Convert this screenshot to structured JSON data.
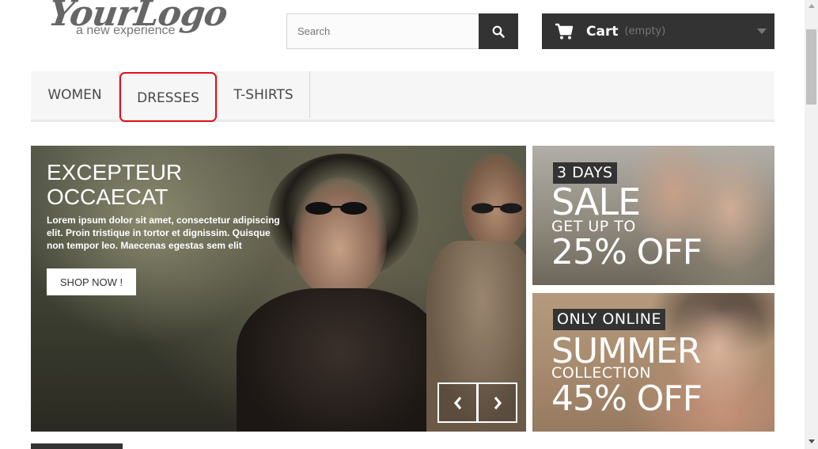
{
  "logo": {
    "script_text": "YourLogo",
    "tagline": "a new experience"
  },
  "search": {
    "placeholder": "Search",
    "value": ""
  },
  "cart": {
    "label": "Cart",
    "status": "(empty)"
  },
  "menu": {
    "items": [
      {
        "label": "WOMEN"
      },
      {
        "label": "DRESSES"
      },
      {
        "label": "T-SHIRTS"
      }
    ],
    "highlight_color": "#e0121a"
  },
  "slider": {
    "heading": "EXCEPTEUR OCCAECAT",
    "text": "Lorem ipsum dolor sit amet, consectetur adipiscing elit. Proin tristique in tortor et dignissim. Quisque non tempor leo. Maecenas egestas sem elit",
    "button_label": "SHOP NOW !"
  },
  "banners": [
    {
      "tag": "3 DAYS",
      "headline": "SALE",
      "subline": "GET UP TO",
      "offer": "25% OFF"
    },
    {
      "tag": "ONLY ONLINE",
      "headline": "SUMMER",
      "subline": "COLLECTION",
      "offer": "45% OFF"
    }
  ],
  "colors": {
    "dark": "#333333",
    "menu_bg": "#f6f6f6",
    "text": "#484848"
  }
}
